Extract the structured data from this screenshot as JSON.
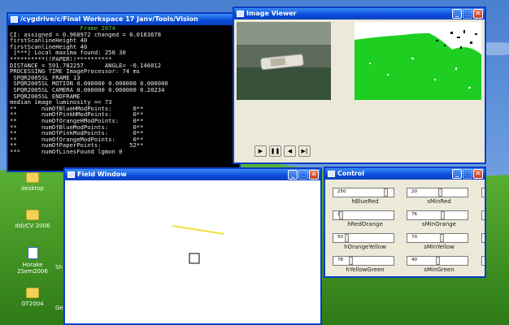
{
  "colors": {
    "desktop_sky": "#5c8fd8",
    "desktop_grass": "#3f9a25",
    "titlebar": "#0a4ad8",
    "console_text": "#e8e8e8",
    "console_accent": "#55cc55",
    "field_line": "#f2e23a"
  },
  "desktop": {
    "icons": [
      {
        "label": "desktop",
        "icon": "folder-icon"
      },
      {
        "label": "ddi/CV 2006",
        "icon": "folder-icon"
      },
      {
        "label": "Horake 2Sem2006",
        "icon": "document-icon"
      },
      {
        "label": "GT2004",
        "icon": "folder-icon"
      }
    ],
    "partial_labels": [
      "Sh",
      "Ge"
    ]
  },
  "console": {
    "title": "/cygdrive/c/Final Workspace 17 Janv/Tools/Vision",
    "lines": [
      "                    Frame 2074",
      "CI: assigned = 0.968972 changed = 0.0183678",
      "firstScanlineHeight 40",
      "firstScanlineHeight 40",
      " [***] Local maxima found: 250 30",
      "**********!!PAPER!!**********",
      "DISTANCE = 591.782257      ANGLE= -0.146012",
      "PROCESSING TIME ImageProcessor: 74 ms",
      " SPQR2005SL FRAME 13",
      " SPQR2005SL MOTION 0.000000 0.000000 0.000000",
      " SPQR2005SL CAMERA 0.000000 0.000000 0.28234",
      " SPQR2005SL ENDFRAME",
      "",
      "median image luminosity == 73",
      "**       numOfBlueHModPoints:      0**",
      "**       numOfPinkHModPoints:      0**",
      "**       numOfOrangeHModPoints:    0**",
      "**       numOfBlueModPoints:       0**",
      "**       numOfPinkModPoints:       0**",
      "**       numOfOrangeModPoints:     0**",
      "**       numOfPaperPoints:        52**",
      "***      numOfLinesFound lgmon 0"
    ]
  },
  "image_viewer": {
    "title": "Image Viewer",
    "buttons": [
      {
        "label": "▶",
        "icon": "play-icon"
      },
      {
        "label": "❚❚",
        "icon": "pause-icon"
      },
      {
        "label": "◀",
        "icon": "step-back-icon"
      },
      {
        "label": "▶|",
        "icon": "step-forward-icon"
      }
    ]
  },
  "field_window": {
    "title": "Field Window"
  },
  "control": {
    "title": "Control",
    "sliders": [
      {
        "value": "250",
        "label": "hBlueRed",
        "level": 0.9
      },
      {
        "value": "20",
        "label": "sMinRed",
        "level": 0.55
      },
      {
        "value": "16",
        "label": "hRedOrange",
        "level": 0.1
      },
      {
        "value": "76",
        "label": "sMinOrange",
        "level": 0.6
      },
      {
        "value": "50",
        "label": "hOrangeYellow",
        "level": 0.2
      },
      {
        "value": "70",
        "label": "sMinYellow",
        "level": 0.58
      },
      {
        "value": "78",
        "label": "hYellowGreen",
        "level": 0.28
      },
      {
        "value": "40",
        "label": "sMinGreen",
        "level": 0.5
      }
    ]
  }
}
